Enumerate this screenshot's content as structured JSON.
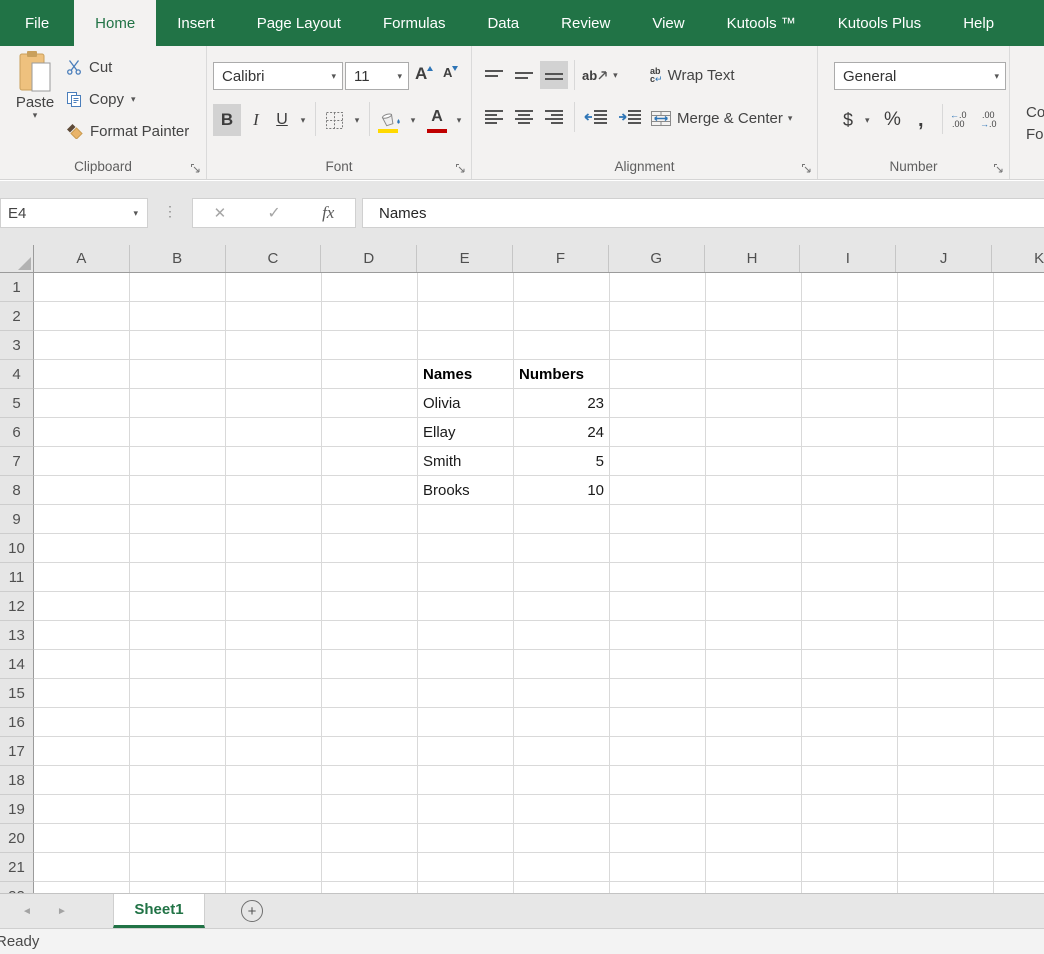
{
  "window": {
    "app": "Microsoft Excel"
  },
  "ribbon_tabs": {
    "items": [
      {
        "label": "File",
        "active": false
      },
      {
        "label": "Home",
        "active": true
      },
      {
        "label": "Insert",
        "active": false
      },
      {
        "label": "Page Layout",
        "active": false
      },
      {
        "label": "Formulas",
        "active": false
      },
      {
        "label": "Data",
        "active": false
      },
      {
        "label": "Review",
        "active": false
      },
      {
        "label": "View",
        "active": false
      },
      {
        "label": "Kutools ™",
        "active": false
      },
      {
        "label": "Kutools Plus",
        "active": false
      },
      {
        "label": "Help",
        "active": false
      }
    ]
  },
  "ribbon": {
    "clipboard": {
      "group_label": "Clipboard",
      "paste_label": "Paste",
      "cut_label": "Cut",
      "copy_label": "Copy",
      "format_painter_label": "Format Painter"
    },
    "font": {
      "group_label": "Font",
      "font_name": "Calibri",
      "font_size": "11",
      "bold_label": "B",
      "italic_label": "I",
      "underline_label": "U",
      "grow_label": "A",
      "shrink_label": "A"
    },
    "alignment": {
      "group_label": "Alignment",
      "wrap_text_label": "Wrap Text",
      "merge_center_label": "Merge & Center",
      "orientation_text": "ab",
      "wrap_icon_line1": "ab",
      "wrap_icon_line2": "c",
      "wrap_icon_arrow": "↵"
    },
    "number": {
      "group_label": "Number",
      "format_value": "General",
      "currency_label": "$",
      "percent_label": "%",
      "comma_label": ",",
      "increase_decimal": {
        "arrow": "←",
        "top": ".0",
        "bottom": ".00"
      },
      "decrease_decimal": {
        "top": ".00",
        "arrow": "→",
        "bottom": ".0"
      }
    },
    "styles_partial": {
      "line1": "Co",
      "line2": "For"
    }
  },
  "formula_bar": {
    "name_box_value": "E4",
    "dots": "⋮",
    "cancel_glyph": "✕",
    "enter_glyph": "✓",
    "fx_label": "fx",
    "content": "Names"
  },
  "grid": {
    "columns": [
      "A",
      "B",
      "C",
      "D",
      "E",
      "F",
      "G",
      "H",
      "I",
      "J",
      "K"
    ],
    "visible_row_count": 22,
    "selected_cell": "E4",
    "cells": [
      {
        "ref": "E4",
        "col": "E",
        "row": 4,
        "value": "Names",
        "bold": true,
        "align": "left"
      },
      {
        "ref": "F4",
        "col": "F",
        "row": 4,
        "value": "Numbers",
        "bold": true,
        "align": "left"
      },
      {
        "ref": "E5",
        "col": "E",
        "row": 5,
        "value": "Olivia",
        "bold": false,
        "align": "left"
      },
      {
        "ref": "F5",
        "col": "F",
        "row": 5,
        "value": "23",
        "bold": false,
        "align": "right"
      },
      {
        "ref": "E6",
        "col": "E",
        "row": 6,
        "value": "Ellay",
        "bold": false,
        "align": "left"
      },
      {
        "ref": "F6",
        "col": "F",
        "row": 6,
        "value": "24",
        "bold": false,
        "align": "right"
      },
      {
        "ref": "E7",
        "col": "E",
        "row": 7,
        "value": "Smith",
        "bold": false,
        "align": "left"
      },
      {
        "ref": "F7",
        "col": "F",
        "row": 7,
        "value": "5",
        "bold": false,
        "align": "right"
      },
      {
        "ref": "E8",
        "col": "E",
        "row": 8,
        "value": "Brooks",
        "bold": false,
        "align": "left"
      },
      {
        "ref": "F8",
        "col": "F",
        "row": 8,
        "value": "10",
        "bold": false,
        "align": "right"
      }
    ]
  },
  "sheet_bar": {
    "nav_left_glyph": "◄",
    "nav_right_glyph": "►",
    "add_glyph": "+",
    "tabs": [
      {
        "label": "Sheet1",
        "active": true
      }
    ]
  },
  "status_bar": {
    "mode": "Ready"
  },
  "icons": {
    "caret_glyph": "▾"
  },
  "colors": {
    "accent_green": "#217346",
    "fill_yellow": "#ffd900",
    "font_color_red": "#c00000",
    "arrow_blue": "#2e75b6",
    "active_button_bg": "#d2d2d2"
  }
}
